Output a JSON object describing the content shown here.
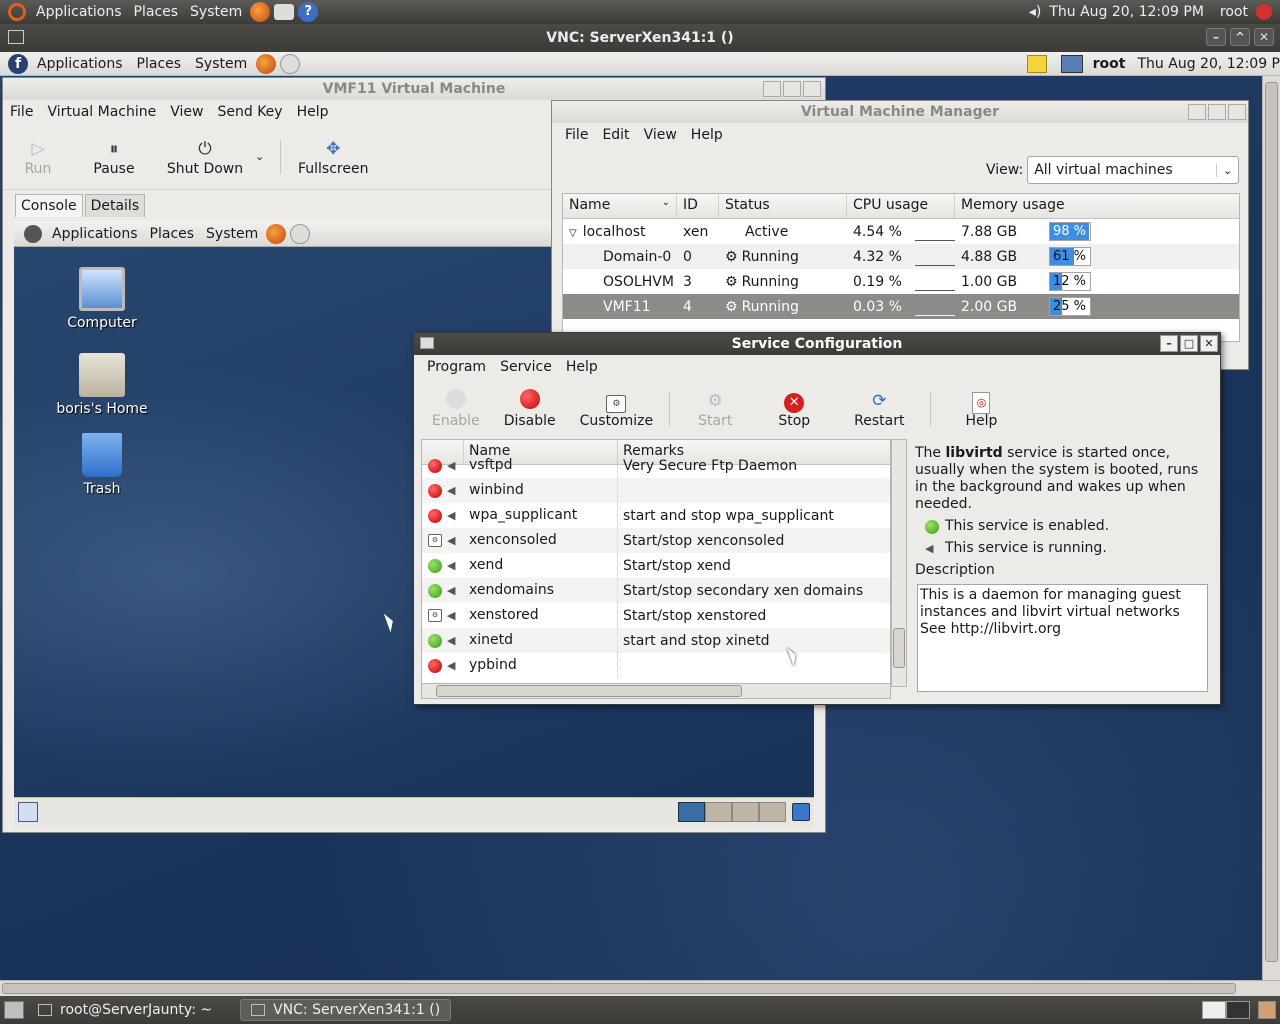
{
  "outer_panel": {
    "menus": [
      "Applications",
      "Places",
      "System"
    ],
    "clock": "Thu Aug 20, 12:09 PM",
    "user": "root"
  },
  "vnc_window": {
    "title": "VNC: ServerXen341:1 ()"
  },
  "inner_panel": {
    "menus": [
      "Applications",
      "Places",
      "System"
    ],
    "user": "root",
    "clock": "Thu Aug 20, 12:09 P"
  },
  "vm_window": {
    "title": "VMF11 Virtual Machine",
    "menus": [
      "File",
      "Virtual Machine",
      "View",
      "Send Key",
      "Help"
    ],
    "toolbar": {
      "run": "Run",
      "pause": "Pause",
      "shutdown": "Shut Down",
      "fullscreen": "Fullscreen"
    },
    "tabs": [
      "Console",
      "Details"
    ],
    "guest_panel": [
      "Applications",
      "Places",
      "System"
    ],
    "desktop_icons": [
      "Computer",
      "boris's Home",
      "Trash"
    ]
  },
  "vmm": {
    "title": "Virtual Machine Manager",
    "menus": [
      "File",
      "Edit",
      "View",
      "Help"
    ],
    "view_label": "View:",
    "view_value": "All virtual machines",
    "columns": [
      "Name",
      "ID",
      "Status",
      "CPU usage",
      "Memory usage"
    ],
    "rows": [
      {
        "name": "localhost",
        "id": "xen",
        "status": "Active",
        "cpu": "4.54 %",
        "mem": "7.88 GB",
        "mem_pct": "98 %",
        "mem_frac": 0.98
      },
      {
        "name": "Domain-0",
        "id": "0",
        "status": "Running",
        "cpu": "4.32 %",
        "mem": "4.88 GB",
        "mem_pct": "61 %",
        "mem_frac": 0.61
      },
      {
        "name": "OSOLHVM",
        "id": "3",
        "status": "Running",
        "cpu": "0.19 %",
        "mem": "1.00 GB",
        "mem_pct": "12 %",
        "mem_frac": 0.12
      },
      {
        "name": "VMF11",
        "id": "4",
        "status": "Running",
        "cpu": "0.03 %",
        "mem": "2.00 GB",
        "mem_pct": "25 %",
        "mem_frac": 0.25
      }
    ]
  },
  "service_config": {
    "title": "Service Configuration",
    "menus": [
      "Program",
      "Service",
      "Help"
    ],
    "toolbar": {
      "enable": "Enable",
      "disable": "Disable",
      "customize": "Customize",
      "start": "Start",
      "stop": "Stop",
      "restart": "Restart",
      "help": "Help"
    },
    "columns": [
      "Name",
      "Remarks"
    ],
    "services": [
      {
        "name": "vsftpd",
        "remark": "Very Secure Ftp Daemon",
        "state": "red"
      },
      {
        "name": "winbind",
        "remark": "",
        "state": "red"
      },
      {
        "name": "wpa_supplicant",
        "remark": "start and stop wpa_supplicant",
        "state": "red"
      },
      {
        "name": "xenconsoled",
        "remark": "Start/stop xenconsoled",
        "state": "mixed"
      },
      {
        "name": "xend",
        "remark": "Start/stop xend",
        "state": "green"
      },
      {
        "name": "xendomains",
        "remark": "Start/stop secondary xen domains",
        "state": "green"
      },
      {
        "name": "xenstored",
        "remark": "Start/stop xenstored",
        "state": "mixed"
      },
      {
        "name": "xinetd",
        "remark": "start and stop xinetd",
        "state": "green"
      },
      {
        "name": "ypbind",
        "remark": "",
        "state": "red"
      }
    ],
    "info": {
      "intro_pre": "The ",
      "service_name": "libvirtd",
      "intro_post": " service is started once, usually when the system is booted, runs in the background and wakes up when needed.",
      "enabled": "This service is enabled.",
      "running": "This service is running.",
      "desc_label": "Description",
      "description": "This is a daemon for managing guest instances and libvirt virtual networks See http://libvirt.org"
    }
  },
  "taskbar": {
    "tasks": [
      "root@ServerJaunty: ~",
      "VNC: ServerXen341:1 ()"
    ]
  }
}
